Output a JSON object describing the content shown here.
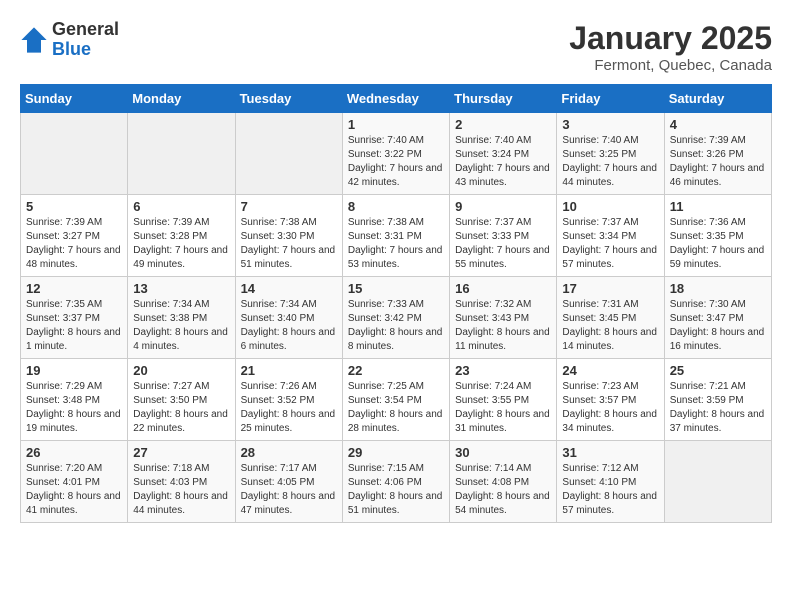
{
  "logo": {
    "general": "General",
    "blue": "Blue"
  },
  "header": {
    "month": "January 2025",
    "location": "Fermont, Quebec, Canada"
  },
  "weekdays": [
    "Sunday",
    "Monday",
    "Tuesday",
    "Wednesday",
    "Thursday",
    "Friday",
    "Saturday"
  ],
  "weeks": [
    [
      {
        "day": "",
        "info": ""
      },
      {
        "day": "",
        "info": ""
      },
      {
        "day": "",
        "info": ""
      },
      {
        "day": "1",
        "info": "Sunrise: 7:40 AM\nSunset: 3:22 PM\nDaylight: 7 hours and 42 minutes."
      },
      {
        "day": "2",
        "info": "Sunrise: 7:40 AM\nSunset: 3:24 PM\nDaylight: 7 hours and 43 minutes."
      },
      {
        "day": "3",
        "info": "Sunrise: 7:40 AM\nSunset: 3:25 PM\nDaylight: 7 hours and 44 minutes."
      },
      {
        "day": "4",
        "info": "Sunrise: 7:39 AM\nSunset: 3:26 PM\nDaylight: 7 hours and 46 minutes."
      }
    ],
    [
      {
        "day": "5",
        "info": "Sunrise: 7:39 AM\nSunset: 3:27 PM\nDaylight: 7 hours and 48 minutes."
      },
      {
        "day": "6",
        "info": "Sunrise: 7:39 AM\nSunset: 3:28 PM\nDaylight: 7 hours and 49 minutes."
      },
      {
        "day": "7",
        "info": "Sunrise: 7:38 AM\nSunset: 3:30 PM\nDaylight: 7 hours and 51 minutes."
      },
      {
        "day": "8",
        "info": "Sunrise: 7:38 AM\nSunset: 3:31 PM\nDaylight: 7 hours and 53 minutes."
      },
      {
        "day": "9",
        "info": "Sunrise: 7:37 AM\nSunset: 3:33 PM\nDaylight: 7 hours and 55 minutes."
      },
      {
        "day": "10",
        "info": "Sunrise: 7:37 AM\nSunset: 3:34 PM\nDaylight: 7 hours and 57 minutes."
      },
      {
        "day": "11",
        "info": "Sunrise: 7:36 AM\nSunset: 3:35 PM\nDaylight: 7 hours and 59 minutes."
      }
    ],
    [
      {
        "day": "12",
        "info": "Sunrise: 7:35 AM\nSunset: 3:37 PM\nDaylight: 8 hours and 1 minute."
      },
      {
        "day": "13",
        "info": "Sunrise: 7:34 AM\nSunset: 3:38 PM\nDaylight: 8 hours and 4 minutes."
      },
      {
        "day": "14",
        "info": "Sunrise: 7:34 AM\nSunset: 3:40 PM\nDaylight: 8 hours and 6 minutes."
      },
      {
        "day": "15",
        "info": "Sunrise: 7:33 AM\nSunset: 3:42 PM\nDaylight: 8 hours and 8 minutes."
      },
      {
        "day": "16",
        "info": "Sunrise: 7:32 AM\nSunset: 3:43 PM\nDaylight: 8 hours and 11 minutes."
      },
      {
        "day": "17",
        "info": "Sunrise: 7:31 AM\nSunset: 3:45 PM\nDaylight: 8 hours and 14 minutes."
      },
      {
        "day": "18",
        "info": "Sunrise: 7:30 AM\nSunset: 3:47 PM\nDaylight: 8 hours and 16 minutes."
      }
    ],
    [
      {
        "day": "19",
        "info": "Sunrise: 7:29 AM\nSunset: 3:48 PM\nDaylight: 8 hours and 19 minutes."
      },
      {
        "day": "20",
        "info": "Sunrise: 7:27 AM\nSunset: 3:50 PM\nDaylight: 8 hours and 22 minutes."
      },
      {
        "day": "21",
        "info": "Sunrise: 7:26 AM\nSunset: 3:52 PM\nDaylight: 8 hours and 25 minutes."
      },
      {
        "day": "22",
        "info": "Sunrise: 7:25 AM\nSunset: 3:54 PM\nDaylight: 8 hours and 28 minutes."
      },
      {
        "day": "23",
        "info": "Sunrise: 7:24 AM\nSunset: 3:55 PM\nDaylight: 8 hours and 31 minutes."
      },
      {
        "day": "24",
        "info": "Sunrise: 7:23 AM\nSunset: 3:57 PM\nDaylight: 8 hours and 34 minutes."
      },
      {
        "day": "25",
        "info": "Sunrise: 7:21 AM\nSunset: 3:59 PM\nDaylight: 8 hours and 37 minutes."
      }
    ],
    [
      {
        "day": "26",
        "info": "Sunrise: 7:20 AM\nSunset: 4:01 PM\nDaylight: 8 hours and 41 minutes."
      },
      {
        "day": "27",
        "info": "Sunrise: 7:18 AM\nSunset: 4:03 PM\nDaylight: 8 hours and 44 minutes."
      },
      {
        "day": "28",
        "info": "Sunrise: 7:17 AM\nSunset: 4:05 PM\nDaylight: 8 hours and 47 minutes."
      },
      {
        "day": "29",
        "info": "Sunrise: 7:15 AM\nSunset: 4:06 PM\nDaylight: 8 hours and 51 minutes."
      },
      {
        "day": "30",
        "info": "Sunrise: 7:14 AM\nSunset: 4:08 PM\nDaylight: 8 hours and 54 minutes."
      },
      {
        "day": "31",
        "info": "Sunrise: 7:12 AM\nSunset: 4:10 PM\nDaylight: 8 hours and 57 minutes."
      },
      {
        "day": "",
        "info": ""
      }
    ]
  ]
}
